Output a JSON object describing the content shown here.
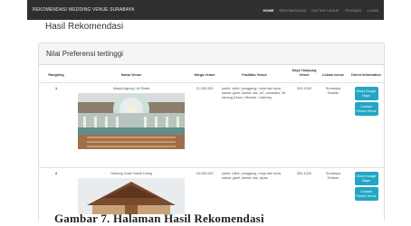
{
  "navbar": {
    "brand": "REKOMENDASI WEDDING VENUE SURABAYA",
    "links": [
      "HOME",
      "REKOMENDASI",
      "DAFTAR VENUE",
      "TENTANG",
      "LOGIN"
    ]
  },
  "page": {
    "title": "Hasil Rekomendasi"
  },
  "panel": {
    "heading": "Nilai Preferensi tertinggi"
  },
  "table": {
    "headers": {
      "rank": "Rangking",
      "name": "Nama Venue",
      "price": "Harga Venue",
      "facilities": "Fasilitas Venue",
      "capacity": "Daya Tampung Venue",
      "location": "Lokasi venue",
      "direct": "Direct Information"
    },
    "rows": [
      {
        "rank": "1",
        "name": "Masjid Agung / Al-Shofa",
        "price": "21.000.000",
        "facilities": "parkir, toilet, panggung, meja dan kursi, kamar ganti, kamar rias, AC, eskalator, lift barang,Dekor, Hiburan, Catering",
        "capacity": "500-1000",
        "location": "Surabaya Selatan",
        "btn_maps": "Direct Google Maps",
        "btn_contact": "Contact Person Venue"
      },
      {
        "rank": "2",
        "name": "Gedung Grahi Satria Dolog",
        "price": "18.000.000",
        "facilities": "parkir, toilet, panggung, meja dan kursi, kamar ganti, kamar rias, kipas",
        "capacity": "500-1000",
        "location": "Surabaya Selatan",
        "btn_maps": "Direct Google Maps",
        "btn_contact": "Contact Person Venue"
      }
    ]
  },
  "caption": "Gambar 7. Halaman Hasil Rekomendasi"
}
